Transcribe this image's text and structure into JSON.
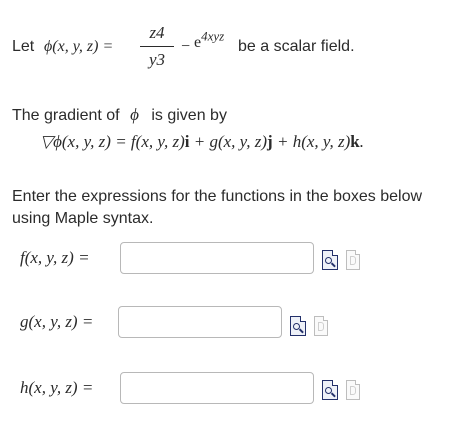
{
  "intro": {
    "prefix": "Let",
    "phi_lhs": "ϕ(x, y, z) =",
    "numerator": "z4",
    "denominator": "y3",
    "minus": "−",
    "exp_base": "e",
    "exp_power": "4xyz",
    "suffix": "be a scalar field."
  },
  "gradient": {
    "text1": "The gradient of",
    "phi": "ϕ",
    "text2": "is given by",
    "equation_parts": [
      "▽ϕ(x, y, z) = f(x, y, z)",
      "i",
      " + g(x, y, z)",
      "j",
      " + h(x, y, z)",
      "k",
      "."
    ]
  },
  "instructions": {
    "line1": "Enter the expressions for the functions in the boxes below",
    "line2": "using Maple syntax."
  },
  "fields": [
    {
      "label": "f(x, y, z) =",
      "value": ""
    },
    {
      "label": "g(x, y, z) =",
      "value": ""
    },
    {
      "label": "h(x, y, z) =",
      "value": ""
    }
  ]
}
